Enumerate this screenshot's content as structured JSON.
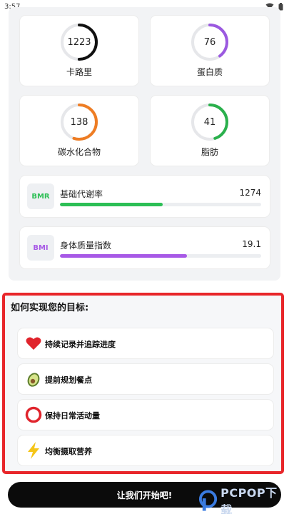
{
  "status_bar": {
    "time": "3:57"
  },
  "macros": [
    {
      "value": "1223",
      "label": "卡路里",
      "progress": 0.5,
      "color": "#111111"
    },
    {
      "value": "76",
      "label": "蛋白质",
      "progress": 0.4,
      "color": "#9b59e0"
    },
    {
      "value": "138",
      "label": "碳水化合物",
      "progress": 0.55,
      "color": "#ee7d24"
    },
    {
      "value": "41",
      "label": "脂肪",
      "progress": 0.45,
      "color": "#2ab04c"
    }
  ],
  "metrics": [
    {
      "badge": "BMR",
      "label": "基础代谢率",
      "value": "1274",
      "progress": 0.51,
      "color": "#2cbf55"
    },
    {
      "badge": "BMI",
      "label": "身体质量指数",
      "value": "19.1",
      "progress": 0.63,
      "color": "#a759e6"
    }
  ],
  "goals": {
    "title": "如何实现您的目标:",
    "items": [
      {
        "text": "持续记录并追踪进度",
        "icon": "heart-icon"
      },
      {
        "text": "提前规划餐点",
        "icon": "avocado-icon"
      },
      {
        "text": "保持日常活动量",
        "icon": "ring-icon"
      },
      {
        "text": "均衡摄取营养",
        "icon": "lightning-icon"
      }
    ]
  },
  "start_button": {
    "label": "让我们开始吧!"
  },
  "watermark": {
    "text": "PCPOP下载"
  }
}
